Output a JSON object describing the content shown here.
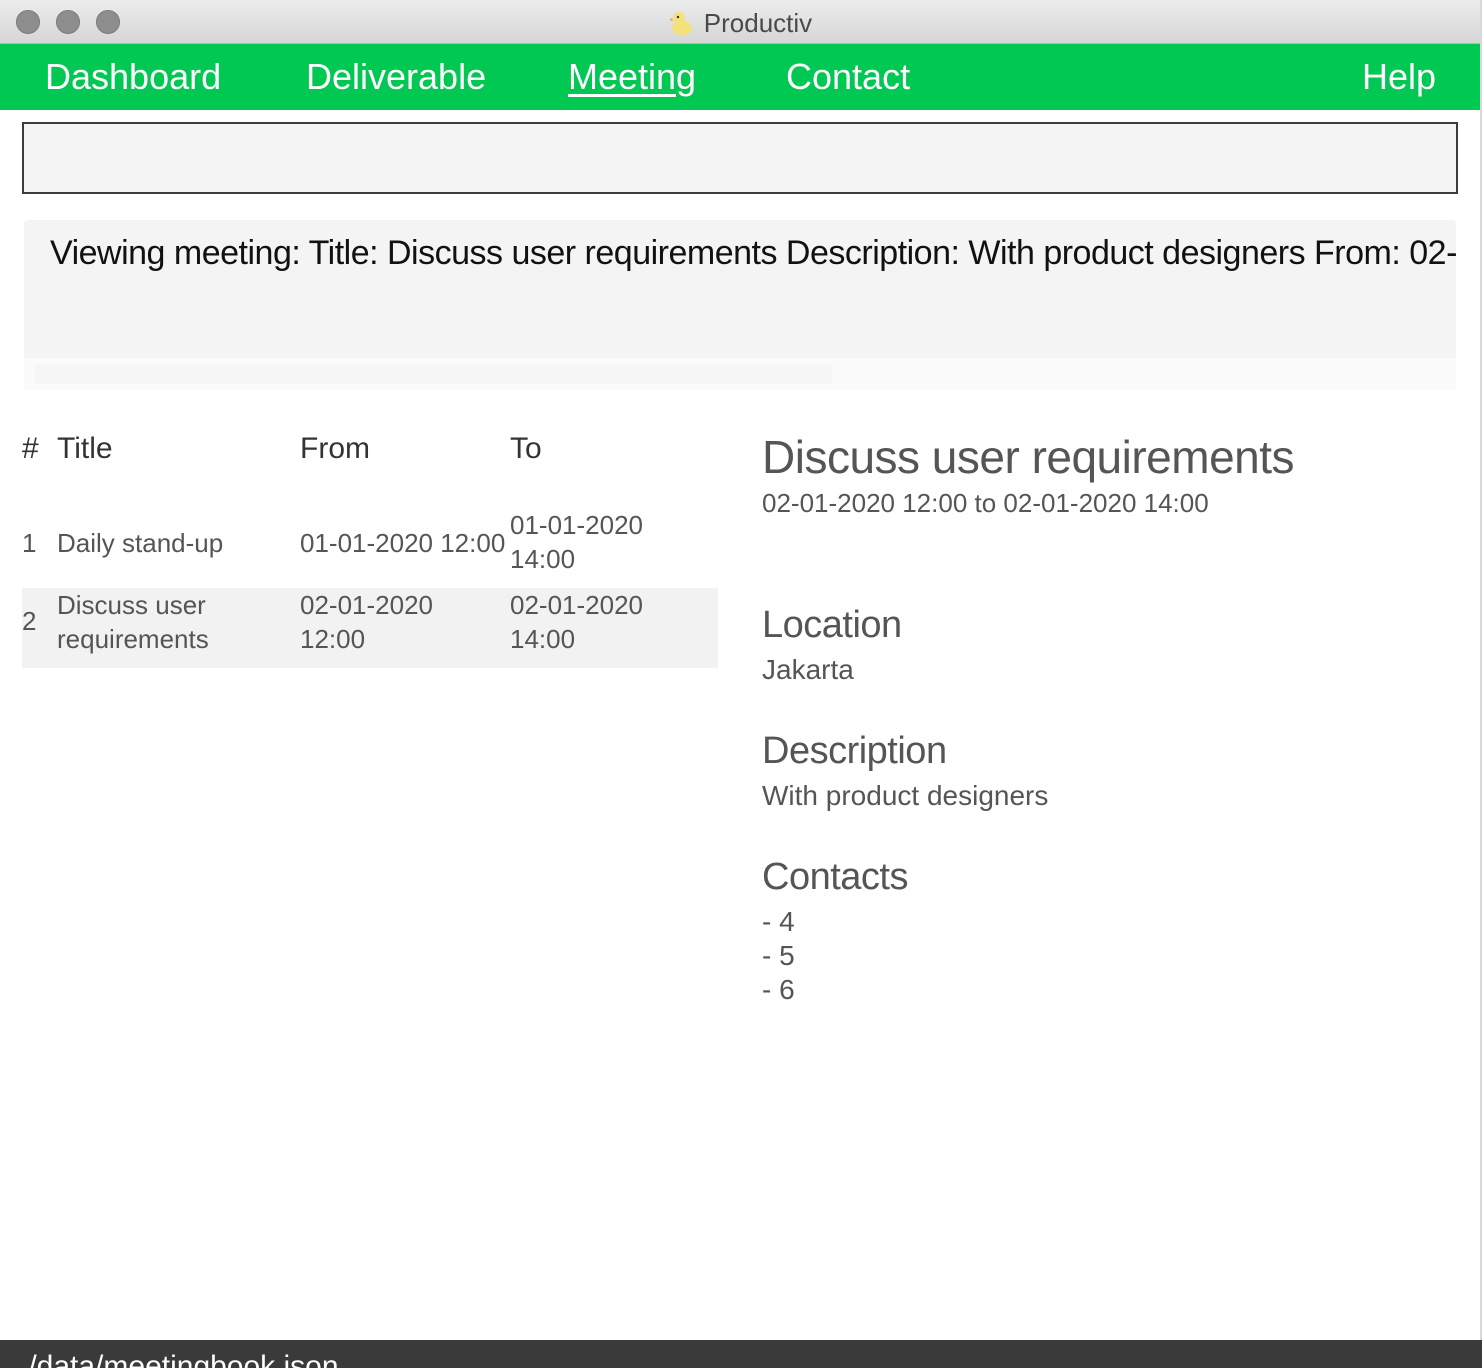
{
  "window": {
    "title": "Productiv"
  },
  "nav": {
    "items": [
      {
        "label": "Dashboard"
      },
      {
        "label": "Deliverable"
      },
      {
        "label": "Meeting"
      },
      {
        "label": "Contact"
      }
    ],
    "active": "Meeting",
    "help": "Help"
  },
  "command": {
    "value": "",
    "placeholder": ""
  },
  "result": {
    "text": "Viewing meeting:  Title: Discuss user requirements Description: With product designers From: 02-"
  },
  "list": {
    "headers": {
      "num": "#",
      "title": "Title",
      "from": "From",
      "to": "To"
    },
    "rows": [
      {
        "num": "1",
        "title": "Daily stand-up",
        "from": "01-01-2020 12:00",
        "to_line1": "01-01-2020",
        "to_line2": "14:00"
      },
      {
        "num": "2",
        "title_line1": "Discuss user",
        "title_line2": "requirements",
        "from_line1": "02-01-2020",
        "from_line2": "12:00",
        "to_line1": "02-01-2020",
        "to_line2": "14:00"
      }
    ]
  },
  "detail": {
    "title": "Discuss user requirements",
    "time": "02-01-2020 12:00 to 02-01-2020 14:00",
    "location_label": "Location",
    "location": "Jakarta",
    "description_label": "Description",
    "description": "With product designers",
    "contacts_label": "Contacts",
    "contacts": [
      "- 4",
      "- 5",
      "- 6"
    ]
  },
  "status": {
    "path": "./data/meetingbook.json"
  },
  "colors": {
    "nav": "#00c853",
    "status": "#3a3a3a"
  }
}
